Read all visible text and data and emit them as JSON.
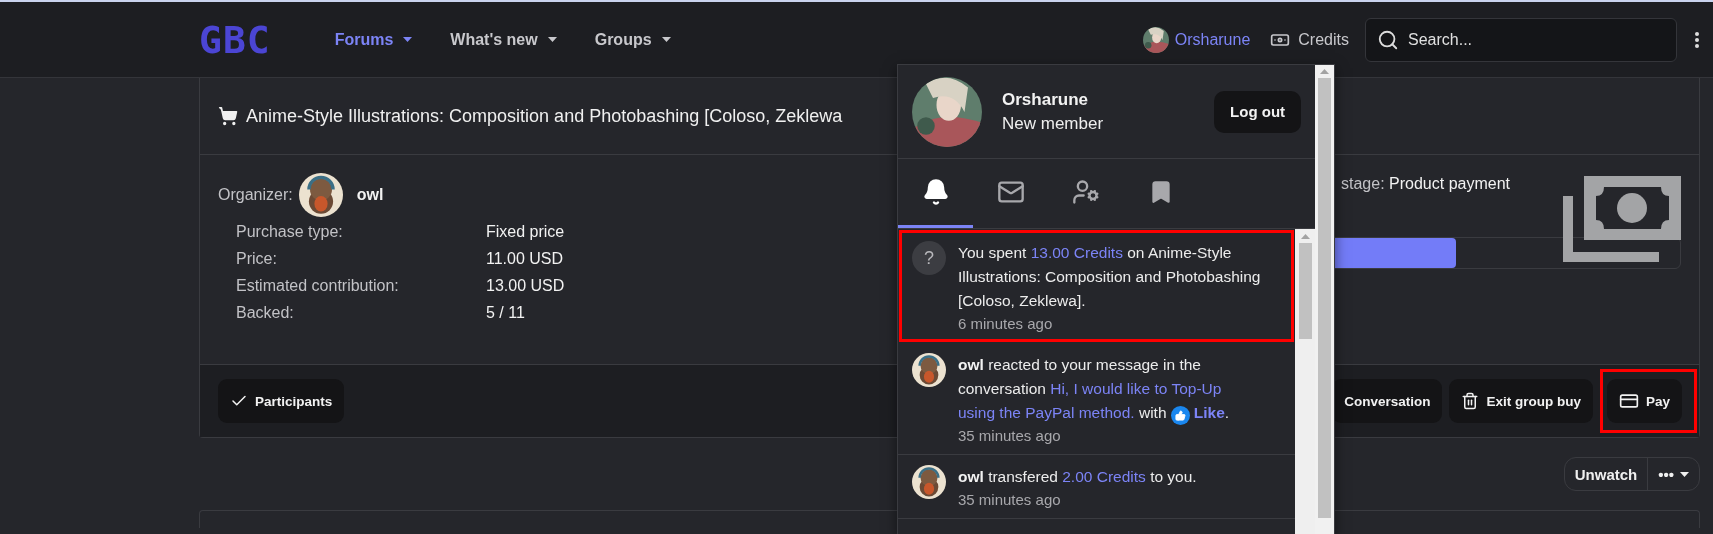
{
  "logo": "GBC",
  "nav": [
    {
      "label": "Forums",
      "selected": true
    },
    {
      "label": "What's new",
      "selected": false
    },
    {
      "label": "Groups",
      "selected": false
    }
  ],
  "user": {
    "name": "Orsharune"
  },
  "credits_link": "Credits",
  "search": {
    "placeholder": "Search..."
  },
  "thread": {
    "title": "Anime-Style Illustrations: Composition and Photobashing [Coloso, Zeklewa",
    "organizer_label": "Organizer:",
    "organizer": "owl",
    "details": [
      {
        "label": "Purchase type:",
        "value": "Fixed price"
      },
      {
        "label": "Price:",
        "value": "11.00 USD"
      },
      {
        "label": "Estimated contribution:",
        "value": "13.00 USD"
      },
      {
        "label": "Backed:",
        "value": "5 / 11"
      }
    ],
    "stage_label": "stage:",
    "stage": "Product payment",
    "progress": {
      "level": 0.67
    },
    "actions_left": [
      {
        "label": "Participants",
        "kind": "check"
      }
    ],
    "actions_right": [
      {
        "label": "Conversation",
        "kind": "plain"
      },
      {
        "label": "Exit group buy",
        "kind": "trash"
      },
      {
        "label": "Pay",
        "kind": "card",
        "highlighted": true
      }
    ]
  },
  "watch": {
    "label": "Unwatch",
    "more": "•••"
  },
  "account_menu": {
    "name": "Orsharune",
    "role": "New member",
    "logout": "Log out",
    "tabs": [
      {
        "kind": "bell",
        "selected": true
      },
      {
        "kind": "mail",
        "selected": false
      },
      {
        "kind": "user-cog",
        "selected": false
      },
      {
        "kind": "bookmark",
        "selected": false
      }
    ],
    "notifications": [
      {
        "kind": "system",
        "badge": "?",
        "highlighted": true,
        "time": "6 minutes ago",
        "parts": [
          {
            "kind": "plain",
            "text": "You spent "
          },
          {
            "kind": "link",
            "text": "13.00 Credits"
          },
          {
            "kind": "plain",
            "text": " on Anime-Style Illustrations: Composition and Photobashing [Coloso, Zeklewa]."
          }
        ]
      },
      {
        "kind": "user",
        "highlighted": false,
        "time": "35 minutes ago",
        "parts": [
          {
            "kind": "user",
            "text": "owl"
          },
          {
            "kind": "plain",
            "text": " reacted to your message in the conversation "
          },
          {
            "kind": "link",
            "text": "Hi, I would like to Top-Up",
            "space_after": true
          },
          {
            "kind": "link",
            "text": "using the PayPal method."
          },
          {
            "kind": "plain",
            "text": " with "
          },
          {
            "kind": "like-icon"
          },
          {
            "kind": "strong-link",
            "text": "Like"
          },
          {
            "kind": "plain",
            "text": "."
          }
        ]
      },
      {
        "kind": "user",
        "highlighted": false,
        "time": "35 minutes ago",
        "parts": [
          {
            "kind": "user",
            "text": "owl"
          },
          {
            "kind": "plain",
            "text": " transfered "
          },
          {
            "kind": "link",
            "text": "2.00 Credits"
          },
          {
            "kind": "plain",
            "text": " to you."
          }
        ]
      }
    ]
  }
}
